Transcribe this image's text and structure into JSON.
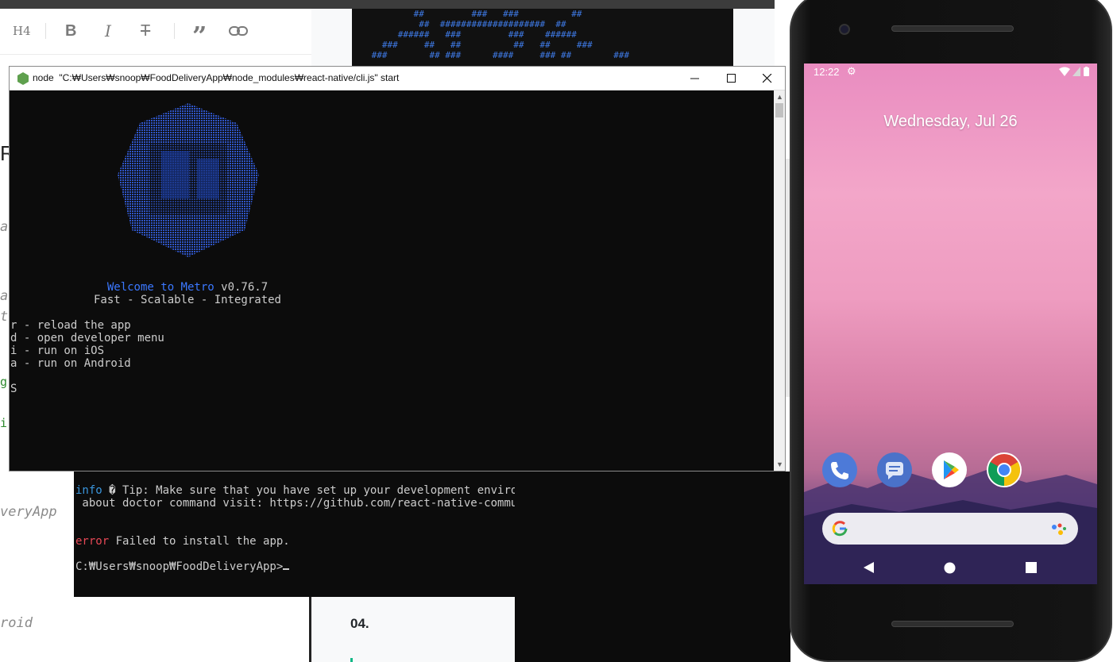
{
  "editor": {
    "toolbar": {
      "h4": "H4",
      "bold": "B",
      "italic": "I",
      "strike": "T",
      "quote": "”",
      "link": "link"
    },
    "fragments": {
      "f1": "R",
      "f2": "a",
      "f3": "a",
      "f4": "t",
      "f5": "g",
      "f6": "i",
      "f7": "veryApp",
      "f8": "roid"
    }
  },
  "preview": {
    "ascii": "         ##         ###   ###          ##\n          ##  ####################  ##\n      ######   ###         ###    ######\n   ###     ##   ##          ##   ##     ###\n ###        ## ###      ####     ### ##        ###",
    "heading": "04."
  },
  "node_window": {
    "title": "node  \"C:₩Users₩snoop₩FoodDeliveryApp₩node_modules₩react-native/cli.js\" start",
    "welcome_prefix": "Welcome to Metro ",
    "version": "v0.76.7",
    "tagline": "Fast - Scalable - Integrated",
    "commands": [
      "r - reload the app",
      "d - open developer menu",
      "i - run on iOS",
      "a - run on Android"
    ],
    "trailing": "S"
  },
  "cmd2": {
    "info_tag": "info",
    "info_line1": " � Tip: Make sure that you have set up your development environme",
    "info_line2": " about doctor command visit: https://github.com/react-native-community",
    "error_tag": "error",
    "error_msg": " Failed to install the app.",
    "prompt": "C:₩Users₩snoop₩FoodDeliveryApp>"
  },
  "phone": {
    "time": "12:22",
    "date": "Wednesday, Jul 26",
    "apps": [
      "phone-app",
      "messages-app",
      "play-store-app",
      "chrome-app"
    ]
  },
  "colors": {
    "metro_blue": "#3b78ff",
    "error_red": "#e74856",
    "info_blue": "#3a96dd",
    "wallpaper_pink": "#f3a6c9"
  }
}
